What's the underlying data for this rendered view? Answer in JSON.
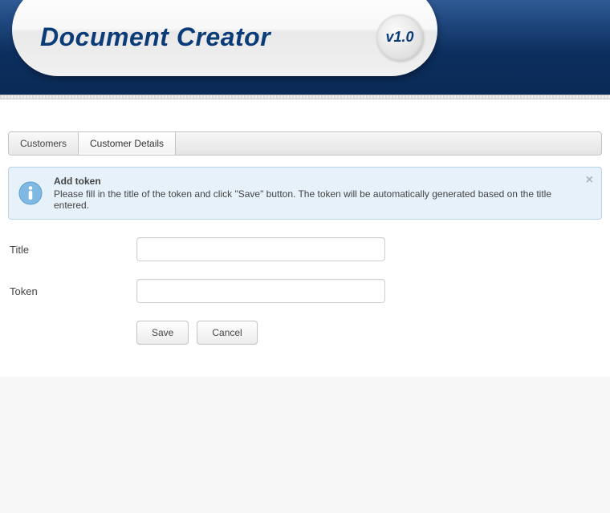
{
  "header": {
    "title": "Document Creator",
    "version": "v1.0"
  },
  "tabs": [
    {
      "label": "Customers",
      "active": false
    },
    {
      "label": "Customer Details",
      "active": true
    }
  ],
  "info": {
    "title": "Add token",
    "message": "Please fill in the title of the token and click \"Save\" button. The token will be automatically generated based on the title entered."
  },
  "form": {
    "title_label": "Title",
    "title_value": "",
    "token_label": "Token",
    "token_value": "",
    "save_label": "Save",
    "cancel_label": "Cancel"
  },
  "colors": {
    "brand": "#0b3c78",
    "info_bg": "#e6f1fa",
    "info_border": "#b6d6e8"
  }
}
